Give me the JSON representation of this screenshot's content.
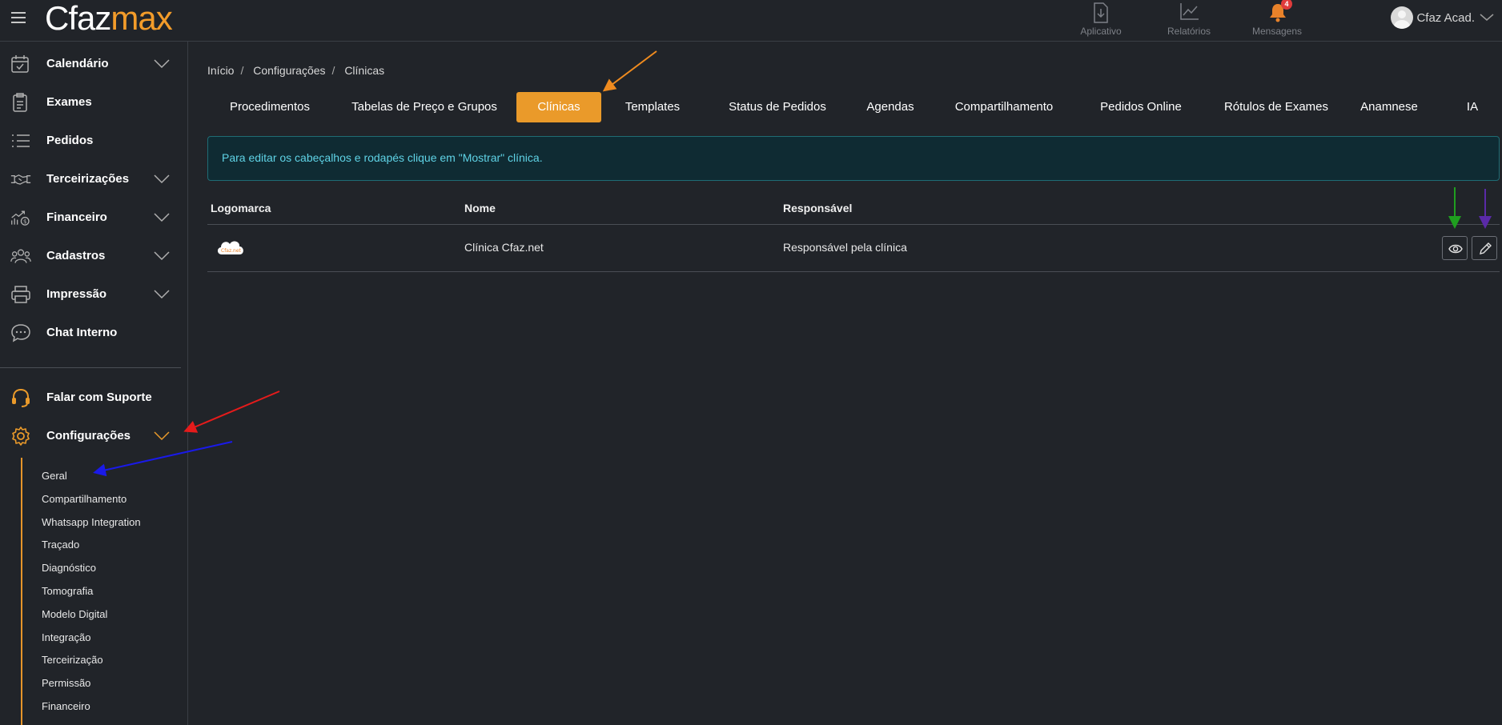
{
  "topbar": {
    "logo_part1": "Cfaz",
    "logo_part2": "max",
    "icons": [
      {
        "name": "aplicativo",
        "label": "Aplicativo",
        "icon": "download-icon"
      },
      {
        "name": "relatorios",
        "label": "Relatórios",
        "icon": "chart-line-icon"
      },
      {
        "name": "mensagens",
        "label": "Mensagens",
        "icon": "bell-icon",
        "badge": "4"
      }
    ],
    "user_name": "Cfaz Acad."
  },
  "sidebar": {
    "items": [
      {
        "label": "Calendário",
        "icon": "calendar-icon",
        "expandable": true
      },
      {
        "label": "Exames",
        "icon": "clipboard-icon",
        "expandable": false
      },
      {
        "label": "Pedidos",
        "icon": "list-icon",
        "expandable": false
      },
      {
        "label": "Terceirizações",
        "icon": "handshake-icon",
        "expandable": true
      },
      {
        "label": "Financeiro",
        "icon": "finance-chart-icon",
        "expandable": true
      },
      {
        "label": "Cadastros",
        "icon": "users-icon",
        "expandable": true
      },
      {
        "label": "Impressão",
        "icon": "printer-icon",
        "expandable": true
      },
      {
        "label": "Chat Interno",
        "icon": "chat-icon",
        "expandable": false
      }
    ],
    "support_label": "Falar com Suporte",
    "config_label": "Configurações",
    "config_subitems": [
      "Geral",
      "Compartilhamento",
      "Whatsapp Integration",
      "Traçado",
      "Diagnóstico",
      "Tomografia",
      "Modelo Digital",
      "Integração",
      "Terceirização",
      "Permissão",
      "Financeiro"
    ]
  },
  "breadcrumb": [
    "Início",
    "Configurações",
    "Clínicas"
  ],
  "tabs": [
    {
      "label": "Procedimentos",
      "active": false
    },
    {
      "label": "Tabelas de Preço e Grupos",
      "active": false
    },
    {
      "label": "Clínicas",
      "active": true
    },
    {
      "label": "Templates",
      "active": false
    },
    {
      "label": "Status de Pedidos",
      "active": false
    },
    {
      "label": "Agendas",
      "active": false
    },
    {
      "label": "Compartilhamento",
      "active": false
    },
    {
      "label": "Pedidos Online",
      "active": false
    },
    {
      "label": "Rótulos de Exames",
      "active": false
    },
    {
      "label": "Anamnese",
      "active": false
    },
    {
      "label": "IA",
      "active": false
    }
  ],
  "alert_text": "Para editar os cabeçalhos e rodapés clique em \"Mostrar\" clínica.",
  "table": {
    "headers": [
      "Logomarca",
      "Nome",
      "Responsável"
    ],
    "rows": [
      {
        "logo_text": "Cfaz.net",
        "name": "Clínica Cfaz.net",
        "responsible": "Responsável pela clínica"
      }
    ]
  },
  "colors": {
    "background": "#212429",
    "accent": "#ea9a2a",
    "alert_bg": "#0f2b33",
    "alert_text": "#5fd3e6",
    "badge": "#e03b3b"
  }
}
